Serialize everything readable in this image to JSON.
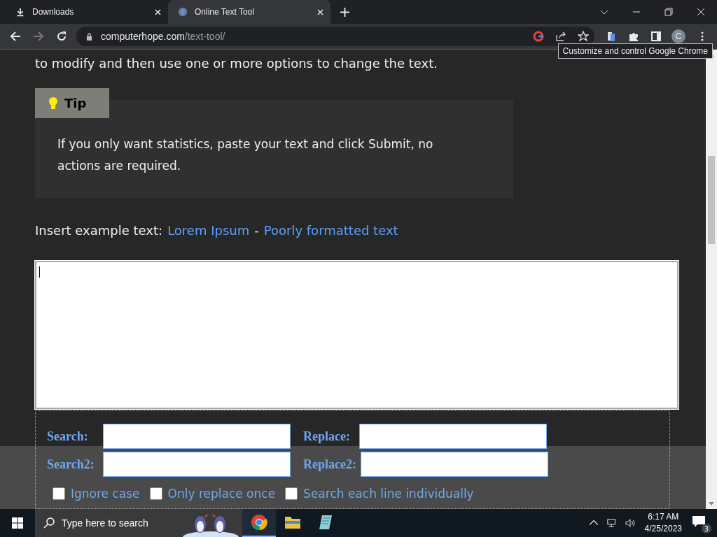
{
  "browser": {
    "tabs": [
      {
        "title": "Downloads",
        "kind": "download",
        "selected": false
      },
      {
        "title": "Online Text Tool",
        "kind": "site",
        "selected": true
      }
    ],
    "address": {
      "host": "computerhope.com",
      "path": "/text-tool/"
    },
    "profile_initial": "C",
    "tooltip": "Customize and control Google Chrome"
  },
  "page": {
    "intro_tail": "to modify and then use one or more options to change the text.",
    "tip": {
      "label": "Tip",
      "text": "If you only want statistics, paste your text and click Submit, no actions are required."
    },
    "example": {
      "label": "Insert example text:",
      "links": [
        "Lorem Ipsum",
        "Poorly formatted text"
      ],
      "separator": "-"
    },
    "fields": [
      {
        "label": "Search:"
      },
      {
        "label": "Replace:"
      },
      {
        "label": "Search2:"
      },
      {
        "label": "Replace2:"
      }
    ],
    "options": [
      {
        "label": "Ignore case",
        "checked": false
      },
      {
        "label": "Only replace once",
        "checked": false
      },
      {
        "label": "Search each line individually",
        "checked": false
      }
    ]
  },
  "taskbar": {
    "search_placeholder": "Type here to search",
    "apps": [
      {
        "kind": "chrome",
        "active": true
      },
      {
        "kind": "folder",
        "active": false
      },
      {
        "kind": "notepad",
        "active": false
      }
    ],
    "time": "6:17 AM",
    "date": "4/25/2023",
    "notifications": "3"
  }
}
